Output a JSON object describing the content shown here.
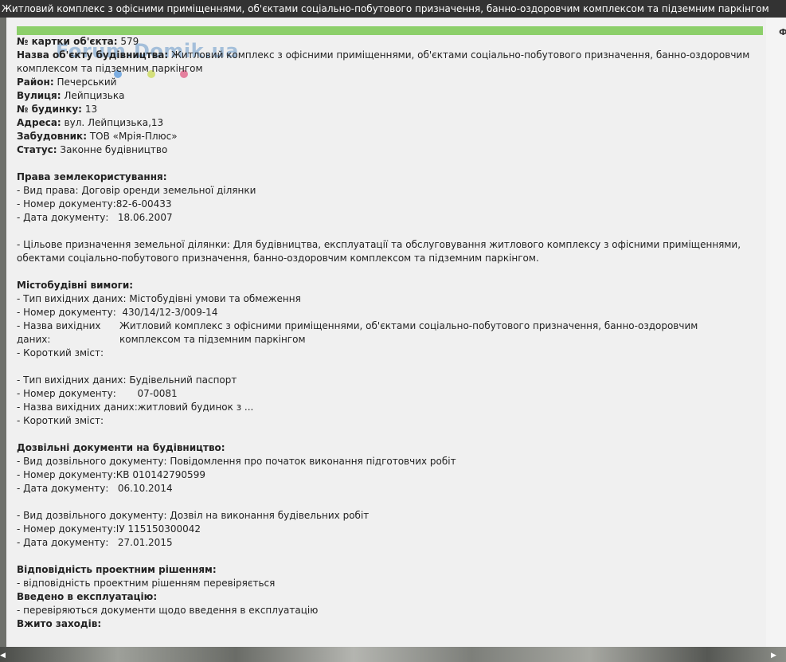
{
  "window": {
    "title": "Житловий комплекс з офісними приміщеннями, об'єктами соціально-побутового призначення, банно-оздоровчим комплексом та підземним паркінгом"
  },
  "right_edge_char": "Ф",
  "watermark": "Forum.Domik.ua",
  "colors": {
    "title_bar": "#333333",
    "accent_bar": "#8ccf6a",
    "panel": "#f0f0f0",
    "watermark_dots": [
      "#4a90d9",
      "#c8d94a",
      "#e0507a"
    ]
  },
  "card": {
    "number_label": "№ картки об'єкта:",
    "number_value": "579",
    "name_label": "Назва об'єкту будівництва:",
    "name_value": "Житловий комплекс з офісними приміщеннями, об'єктами соціально-побутового призначення, банно-оздоровчим комплексом та підземним паркінгом",
    "district_label": "Район:",
    "district_value": "Печерський",
    "street_label": "Вулиця:",
    "street_value": "Лейпцизька",
    "building_label": "№ будинку:",
    "building_value": "13",
    "address_label": "Адреса:",
    "address_value": "вул. Лейпцизька,13",
    "developer_label": "Забудовник:",
    "developer_value": "ТОВ «Мрія-Плюс»",
    "status_label": "Статус:",
    "status_value": "Законне будівництво"
  },
  "land": {
    "heading": "Права землекористування:",
    "right_type": "- Вид права: Договір оренди земельної ділянки",
    "doc_number": "- Номер документу:82-6-00433",
    "doc_date": "- Дата документу:   18.06.2007",
    "purpose": "- Цільове призначення земельної ділянки: Для будівництва, експлуатації та обслуговування житлового комплексу з офісними приміщеннями, обектами соціально-побутового призначення, банно-оздоровчим комплексом та підземним паркінгом."
  },
  "urban": {
    "heading": "Містобудівні вимоги:",
    "item1": {
      "type": "- Тип вихідних даних: Містобудівні умови та обмеження",
      "doc_number": "- Номер документу:  430/14/12-3/009-14",
      "name_label": "- Назва вихідних даних:",
      "name_value": "Житловий комплекс з офісними приміщеннями, об'єктами соціально-побутового призначення, банно-оздоровчим комплексом та підземним паркінгом",
      "summary": "- Короткий зміст:"
    },
    "item2": {
      "type": "- Тип вихідних даних: Будівельний паспорт",
      "doc_number": "- Номер документу:       07-0081",
      "name": "- Назва вихідних даних:житловий будинок з ...",
      "summary": "- Короткий зміст:"
    }
  },
  "permits": {
    "heading": "Дозвільні документи на будівництво:",
    "item1": {
      "type": "- Вид дозвільного документу: Повідомлення про початок виконання підготовчих робіт",
      "doc_number": "- Номер документу:КВ 010142790599",
      "doc_date": "- Дата документу:   06.10.2014"
    },
    "item2": {
      "type": "- Вид дозвільного документу: Дозвіл на виконання будівельних робіт",
      "doc_number": "- Номер документу:ІУ 115150300042",
      "doc_date": "- Дата документу:   27.01.2015"
    }
  },
  "compliance": {
    "heading": "Відповідність проектним рішенням:",
    "text": "- відповідність проектним рішенням перевіряється"
  },
  "commissioning": {
    "heading": "Введено в експлуатацію:",
    "text": "- перевіряються документи щодо введення в експлуатацію"
  },
  "measures": {
    "heading": "Вжито заходів:"
  }
}
